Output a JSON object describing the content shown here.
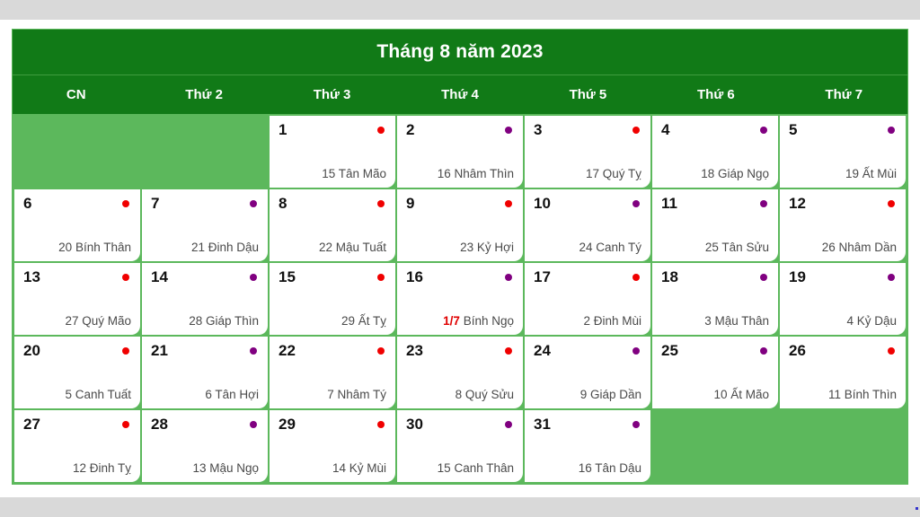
{
  "calendar": {
    "title": "Tháng 8 năm 2023",
    "weekdays": [
      "CN",
      "Thứ 2",
      "Thứ 3",
      "Thứ 4",
      "Thứ 5",
      "Thứ 6",
      "Thứ 7"
    ],
    "colors": {
      "header_green": "#117a17",
      "cell_green": "#5cb85c",
      "dot_red": "#f00000",
      "dot_purple": "#800080",
      "lunar_highlight_red": "#e00000",
      "browser_band_gray": "#d9d9d9"
    },
    "cells": [
      {
        "empty": true
      },
      {
        "empty": true
      },
      {
        "day": "1",
        "dot": "red",
        "lunar_lead": "",
        "lunar": "15 Tân Mão"
      },
      {
        "day": "2",
        "dot": "purple",
        "lunar_lead": "",
        "lunar": "16 Nhâm Thìn"
      },
      {
        "day": "3",
        "dot": "red",
        "lunar_lead": "",
        "lunar": "17 Quý Tỵ"
      },
      {
        "day": "4",
        "dot": "purple",
        "lunar_lead": "",
        "lunar": "18 Giáp Ngọ"
      },
      {
        "day": "5",
        "dot": "purple",
        "lunar_lead": "",
        "lunar": "19 Ất Mùi"
      },
      {
        "day": "6",
        "dot": "red",
        "lunar_lead": "",
        "lunar": "20 Bính Thân"
      },
      {
        "day": "7",
        "dot": "purple",
        "lunar_lead": "",
        "lunar": "21 Đinh Dậu"
      },
      {
        "day": "8",
        "dot": "red",
        "lunar_lead": "",
        "lunar": "22 Mậu Tuất"
      },
      {
        "day": "9",
        "dot": "red",
        "lunar_lead": "",
        "lunar": "23 Kỷ Hợi"
      },
      {
        "day": "10",
        "dot": "purple",
        "lunar_lead": "",
        "lunar": "24 Canh Tý"
      },
      {
        "day": "11",
        "dot": "purple",
        "lunar_lead": "",
        "lunar": "25 Tân Sửu"
      },
      {
        "day": "12",
        "dot": "red",
        "lunar_lead": "",
        "lunar": "26 Nhâm Dần"
      },
      {
        "day": "13",
        "dot": "red",
        "lunar_lead": "",
        "lunar": "27 Quý Mão"
      },
      {
        "day": "14",
        "dot": "purple",
        "lunar_lead": "",
        "lunar": "28 Giáp Thìn"
      },
      {
        "day": "15",
        "dot": "red",
        "lunar_lead": "",
        "lunar": "29 Ất Tỵ"
      },
      {
        "day": "16",
        "dot": "purple",
        "lunar_lead": "1/7",
        "lunar": " Bính Ngọ"
      },
      {
        "day": "17",
        "dot": "red",
        "lunar_lead": "",
        "lunar": "2 Đinh Mùi"
      },
      {
        "day": "18",
        "dot": "purple",
        "lunar_lead": "",
        "lunar": "3 Mậu Thân"
      },
      {
        "day": "19",
        "dot": "purple",
        "lunar_lead": "",
        "lunar": "4 Kỷ Dậu"
      },
      {
        "day": "20",
        "dot": "red",
        "lunar_lead": "",
        "lunar": "5 Canh Tuất"
      },
      {
        "day": "21",
        "dot": "purple",
        "lunar_lead": "",
        "lunar": "6 Tân Hợi"
      },
      {
        "day": "22",
        "dot": "red",
        "lunar_lead": "",
        "lunar": "7 Nhâm Tý"
      },
      {
        "day": "23",
        "dot": "red",
        "lunar_lead": "",
        "lunar": "8 Quý Sửu"
      },
      {
        "day": "24",
        "dot": "purple",
        "lunar_lead": "",
        "lunar": "9 Giáp Dần"
      },
      {
        "day": "25",
        "dot": "purple",
        "lunar_lead": "",
        "lunar": "10 Ất Mão"
      },
      {
        "day": "26",
        "dot": "red",
        "lunar_lead": "",
        "lunar": "11 Bính Thìn"
      },
      {
        "day": "27",
        "dot": "red",
        "lunar_lead": "",
        "lunar": "12 Đinh Tỵ"
      },
      {
        "day": "28",
        "dot": "purple",
        "lunar_lead": "",
        "lunar": "13 Mậu Ngọ"
      },
      {
        "day": "29",
        "dot": "red",
        "lunar_lead": "",
        "lunar": "14 Kỷ Mùi"
      },
      {
        "day": "30",
        "dot": "purple",
        "lunar_lead": "",
        "lunar": "15 Canh Thân"
      },
      {
        "day": "31",
        "dot": "purple",
        "lunar_lead": "",
        "lunar": "16 Tân Dậu"
      },
      {
        "empty": true
      },
      {
        "empty": true
      }
    ]
  }
}
